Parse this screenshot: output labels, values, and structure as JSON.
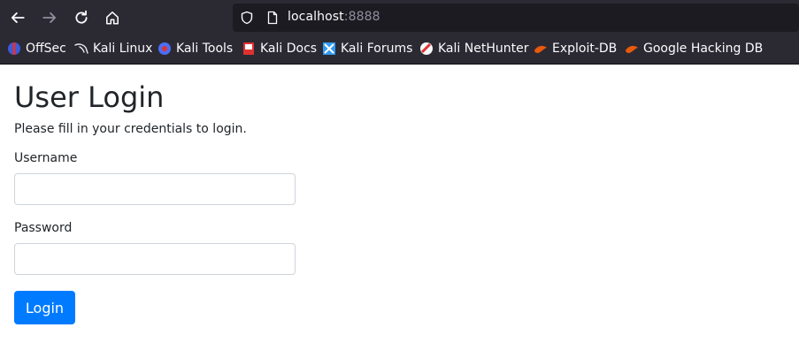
{
  "browser": {
    "url_host": "localhost",
    "url_port": ":8888",
    "bookmarks": [
      {
        "label": "OffSec",
        "icon": "offsec-icon"
      },
      {
        "label": "Kali Linux",
        "icon": "kali-dragon-icon"
      },
      {
        "label": "Kali Tools",
        "icon": "kali-tools-icon"
      },
      {
        "label": "Kali Docs",
        "icon": "kali-docs-icon"
      },
      {
        "label": "Kali Forums",
        "icon": "kali-forums-icon"
      },
      {
        "label": "Kali NetHunter",
        "icon": "kali-nethunter-icon"
      },
      {
        "label": "Exploit-DB",
        "icon": "exploit-db-icon"
      },
      {
        "label": "Google Hacking DB",
        "icon": "ghdb-icon"
      }
    ]
  },
  "page": {
    "title": "User Login",
    "subtitle": "Please fill in your credentials to login.",
    "username_label": "Username",
    "username_value": "",
    "password_label": "Password",
    "password_value": "",
    "login_button": "Login"
  },
  "colors": {
    "toolbar_bg": "#2b2a33",
    "urlbar_bg": "#1c1b22",
    "primary": "#007bff",
    "text": "#212529"
  }
}
